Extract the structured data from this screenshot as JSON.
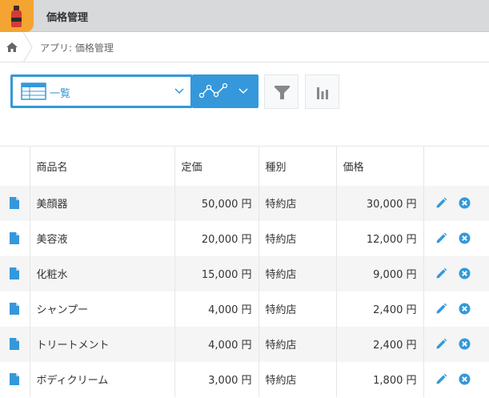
{
  "app": {
    "title": "価格管理"
  },
  "breadcrumb": {
    "text": "アプリ: 価格管理"
  },
  "view": {
    "label": "一覧"
  },
  "table": {
    "headers": [
      "商品名",
      "定価",
      "種別",
      "価格"
    ],
    "rows": [
      {
        "name": "美顔器",
        "list_price": "50,000 円",
        "type": "特約店",
        "price": "30,000 円"
      },
      {
        "name": "美容液",
        "list_price": "20,000 円",
        "type": "特約店",
        "price": "12,000 円"
      },
      {
        "name": "化粧水",
        "list_price": "15,000 円",
        "type": "特約店",
        "price": "9,000 円"
      },
      {
        "name": "シャンプー",
        "list_price": "4,000 円",
        "type": "特約店",
        "price": "2,400 円"
      },
      {
        "name": "トリートメント",
        "list_price": "4,000 円",
        "type": "特約店",
        "price": "2,400 円"
      },
      {
        "name": "ボディクリーム",
        "list_price": "3,000 円",
        "type": "特約店",
        "price": "1,800 円"
      }
    ]
  },
  "colors": {
    "accent": "#3498db",
    "header_bg": "#d7d9db",
    "app_icon_bg": "#f4a431"
  },
  "icons": {
    "app": "cosmetics-bottle-icon",
    "home": "home-icon",
    "view": "table-view-icon",
    "graph": "line-graph-icon",
    "filter": "filter-icon",
    "chart": "bar-chart-icon",
    "record": "document-icon",
    "edit": "pencil-icon",
    "delete": "close-circle-icon"
  }
}
